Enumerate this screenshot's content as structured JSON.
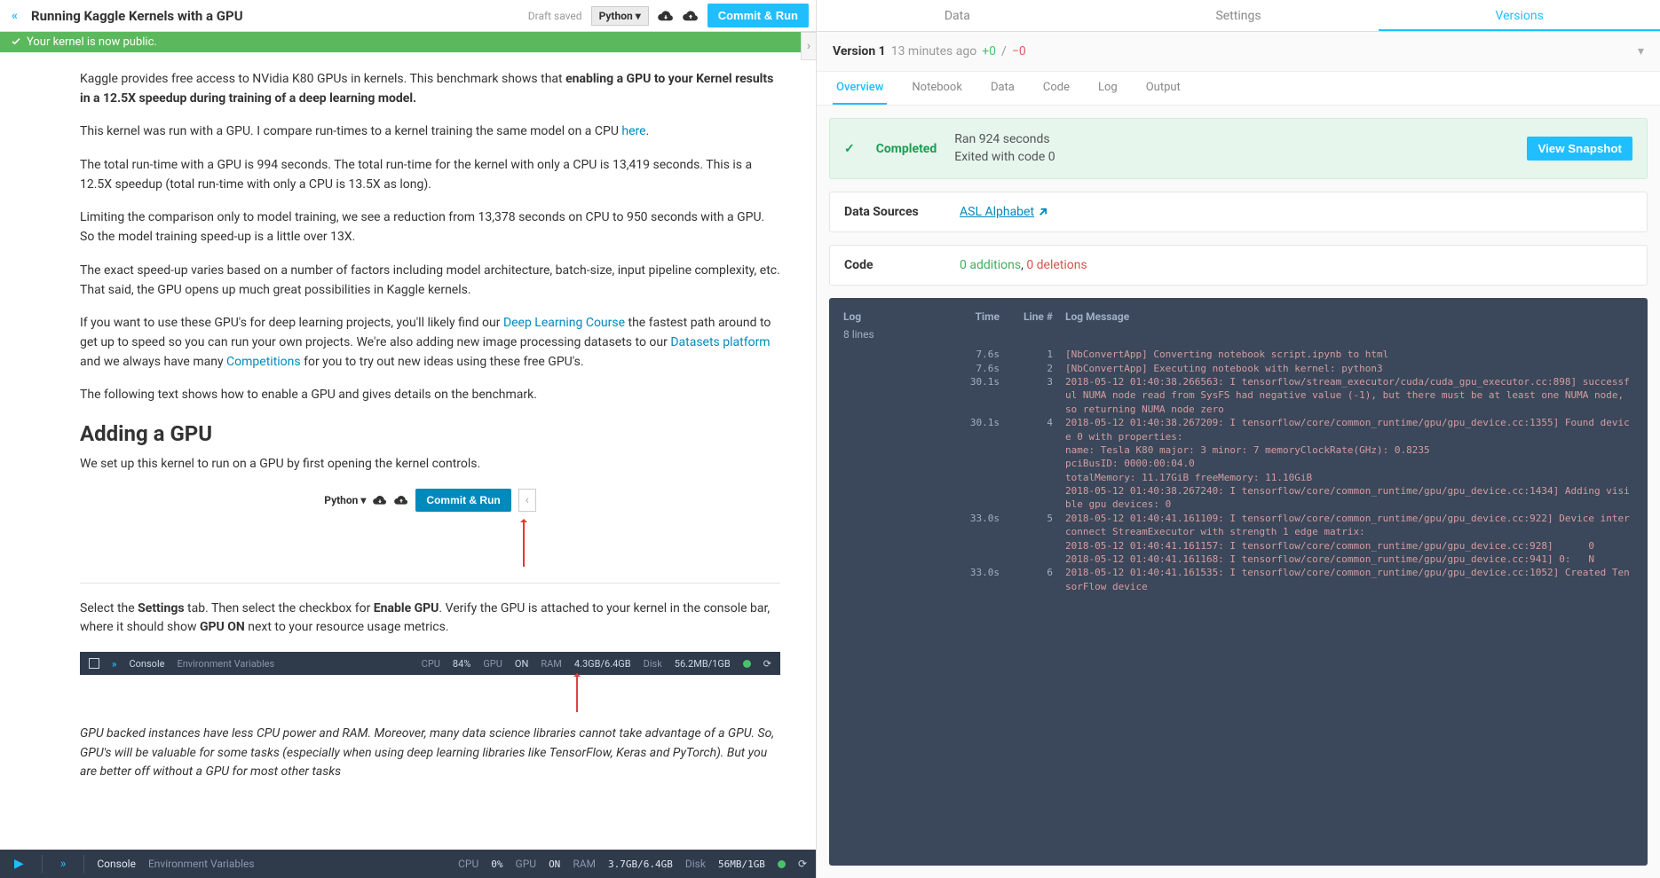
{
  "header": {
    "title": "Running Kaggle Kernels with a GPU",
    "draft_saved": "Draft saved",
    "language": "Python ▾",
    "commit_run": "Commit & Run"
  },
  "banner": {
    "text": "Your kernel is now public."
  },
  "content": {
    "p1a": "Kaggle provides free access to NVidia K80 GPUs in kernels. This benchmark shows that ",
    "p1b": "enabling a GPU to your Kernel results in a 12.5X speedup during training of a deep learning model.",
    "p2a": "This kernel was run with a GPU. I compare run-times to a kernel training the same model on a CPU ",
    "p2link": "here",
    "p2b": ".",
    "p3": "The total run-time with a GPU is 994 seconds. The total run-time for the kernel with only a CPU is 13,419 seconds. This is a 12.5X speedup (total run-time with only a CPU is 13.5X as long).",
    "p4": "Limiting the comparison only to model training, we see a reduction from 13,378 seconds on CPU to 950 seconds with a GPU. So the model training speed-up is a little over 13X.",
    "p5": "The exact speed-up varies based on a number of factors including model architecture, batch-size, input pipeline complexity, etc. That said, the GPU opens up much great possibilities in Kaggle kernels.",
    "p6a": "If you want to use these GPU's for deep learning projects, you'll likely find our ",
    "p6l1": "Deep Learning Course",
    "p6b": " the fastest path around to get up to speed so you can run your own projects. We're also adding new image processing datasets to our ",
    "p6l2": "Datasets platform",
    "p6c": " and we always have many ",
    "p6l3": "Competitions",
    "p6d": " for you to try out new ideas using these free GPU's.",
    "p7": "The following text shows how to enable a GPU and gives details on the benchmark.",
    "h2": "Adding a GPU",
    "p8": "We set up this kernel to run on a GPU by first opening the kernel controls.",
    "mini_lang": "Python ▾",
    "mini_cnr": "Commit & Run",
    "p9a": "Select the ",
    "p9b": "Settings",
    "p9c": " tab. Then select the checkbox for ",
    "p9d": "Enable GPU",
    "p9e": ". Verify the GPU is attached to your kernel in the console bar, where it should show ",
    "p9f": "GPU ON",
    "p9g": " next to your resource usage metrics.",
    "console": {
      "label": "Console",
      "env": "Environment Variables",
      "cpu_l": "CPU",
      "cpu_v": "84%",
      "gpu_l": "GPU",
      "gpu_v": "ON",
      "ram_l": "RAM",
      "ram_v": "4.3GB/6.4GB",
      "disk_l": "Disk",
      "disk_v": "56.2MB/1GB"
    },
    "p10": "GPU backed instances have less CPU power and RAM. Moreover, many data science libraries cannot take advantage of a GPU. So, GPU's will be valuable for some tasks (especially when using deep learning libraries like TensorFlow, Keras and PyTorch). But you are better off without a GPU for most other tasks"
  },
  "bottom": {
    "console": "Console",
    "env": "Environment Variables",
    "cpu_l": "CPU",
    "cpu_v": "0%",
    "gpu_l": "GPU",
    "gpu_v": "ON",
    "ram_l": "RAM",
    "ram_v": "3.7GB/6.4GB",
    "disk_l": "Disk",
    "disk_v": "56MB/1GB"
  },
  "right": {
    "tabs": {
      "data": "Data",
      "settings": "Settings",
      "versions": "Versions"
    },
    "version": {
      "name": "Version 1",
      "ago": "13 minutes ago",
      "plus": "+0",
      "slash": "/",
      "minus": "−0"
    },
    "subtabs": {
      "overview": "Overview",
      "notebook": "Notebook",
      "data": "Data",
      "code": "Code",
      "log": "Log",
      "output": "Output"
    },
    "status": {
      "completed": "Completed",
      "line1": "Ran 924 seconds",
      "line2": "Exited with code 0",
      "snapshot": "View Snapshot"
    },
    "datasources": {
      "label": "Data Sources",
      "link": "ASL Alphabet"
    },
    "code": {
      "label": "Code",
      "add": "0 additions",
      "comma": ", ",
      "del": "0 deletions"
    },
    "log": {
      "title": "Log",
      "sub": "8 lines",
      "h_time": "Time",
      "h_line": "Line #",
      "h_msg": "Log Message",
      "rows": [
        {
          "t": "7.6s",
          "n": "1",
          "m": "[NbConvertApp] Converting notebook script.ipynb to html"
        },
        {
          "t": "7.6s",
          "n": "2",
          "m": "[NbConvertApp] Executing notebook with kernel: python3"
        },
        {
          "t": "30.1s",
          "n": "3",
          "m": "2018-05-12 01:40:38.266563: I tensorflow/stream_executor/cuda/cuda_gpu_executor.cc:898] successful NUMA node read from SysFS had negative value (-1), but there must be at least one NUMA node, so returning NUMA node zero"
        },
        {
          "t": "30.1s",
          "n": "4",
          "m": "2018-05-12 01:40:38.267209: I tensorflow/core/common_runtime/gpu/gpu_device.cc:1355] Found device 0 with properties:\nname: Tesla K80 major: 3 minor: 7 memoryClockRate(GHz): 0.8235\npciBusID: 0000:00:04.0\ntotalMemory: 11.17GiB freeMemory: 11.10GiB\n2018-05-12 01:40:38.267240: I tensorflow/core/common_runtime/gpu/gpu_device.cc:1434] Adding visible gpu devices: 0"
        },
        {
          "t": "33.0s",
          "n": "5",
          "m": "2018-05-12 01:40:41.161109: I tensorflow/core/common_runtime/gpu/gpu_device.cc:922] Device interconnect StreamExecutor with strength 1 edge matrix:\n2018-05-12 01:40:41.161157: I tensorflow/core/common_runtime/gpu/gpu_device.cc:928]      0\n2018-05-12 01:40:41.161168: I tensorflow/core/common_runtime/gpu/gpu_device.cc:941] 0:   N"
        },
        {
          "t": "33.0s",
          "n": "6",
          "m": "2018-05-12 01:40:41.161535: I tensorflow/core/common_runtime/gpu/gpu_device.cc:1052] Created TensorFlow device"
        }
      ]
    }
  }
}
